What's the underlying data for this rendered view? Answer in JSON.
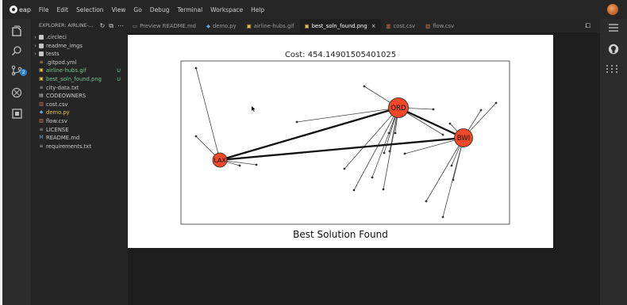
{
  "menubar": {
    "logo_text": "eap",
    "items": [
      "File",
      "Edit",
      "Selection",
      "View",
      "Go",
      "Debug",
      "Terminal",
      "Workspace",
      "Help"
    ]
  },
  "explorer": {
    "title": "EXPLORER: AIRLINE-...",
    "items": [
      {
        "label": ".circleci",
        "kind": "folder",
        "chevron": ">",
        "status": ""
      },
      {
        "label": "readme_imgs",
        "kind": "folder",
        "chevron": ">",
        "status": ""
      },
      {
        "label": "tests",
        "kind": "folder",
        "chevron": ">",
        "status": ""
      },
      {
        "label": ".gitpod.yml",
        "kind": "yml",
        "status": ""
      },
      {
        "label": "airline-hubs.gif",
        "kind": "image",
        "status": "U"
      },
      {
        "label": "best_soln_found.png",
        "kind": "image",
        "status": "U"
      },
      {
        "label": "city-data.txt",
        "kind": "text",
        "status": ""
      },
      {
        "label": "CODEOWNERS",
        "kind": "text",
        "status": ""
      },
      {
        "label": "cost.csv",
        "kind": "csv",
        "status": ""
      },
      {
        "label": "demo.py",
        "kind": "python",
        "status": ""
      },
      {
        "label": "flow.csv",
        "kind": "csv",
        "status": ""
      },
      {
        "label": "LICENSE",
        "kind": "text",
        "status": ""
      },
      {
        "label": "README.md",
        "kind": "markdown",
        "status": ""
      },
      {
        "label": "requirements.txt",
        "kind": "text",
        "status": ""
      }
    ]
  },
  "tabs": [
    {
      "label": "Preview README.md",
      "icon": "preview"
    },
    {
      "label": "demo.py",
      "icon": "python"
    },
    {
      "label": "airline-hubs.gif",
      "icon": "image"
    },
    {
      "label": "best_soln_found.png",
      "icon": "image",
      "active": true
    },
    {
      "label": "cost.csv",
      "icon": "csv"
    },
    {
      "label": "flow.csv",
      "icon": "csv"
    }
  ],
  "figure": {
    "cost_title": "Cost: 454.14901505401025",
    "caption": "Best Solution Found",
    "hubs": [
      "LAX",
      "ORD",
      "BWI"
    ]
  },
  "colors": {
    "hub_fill": "#f04828",
    "accent_blue": "#2f7fd0",
    "untracked": "#73c991",
    "python_yellow": "#e8c24a"
  }
}
